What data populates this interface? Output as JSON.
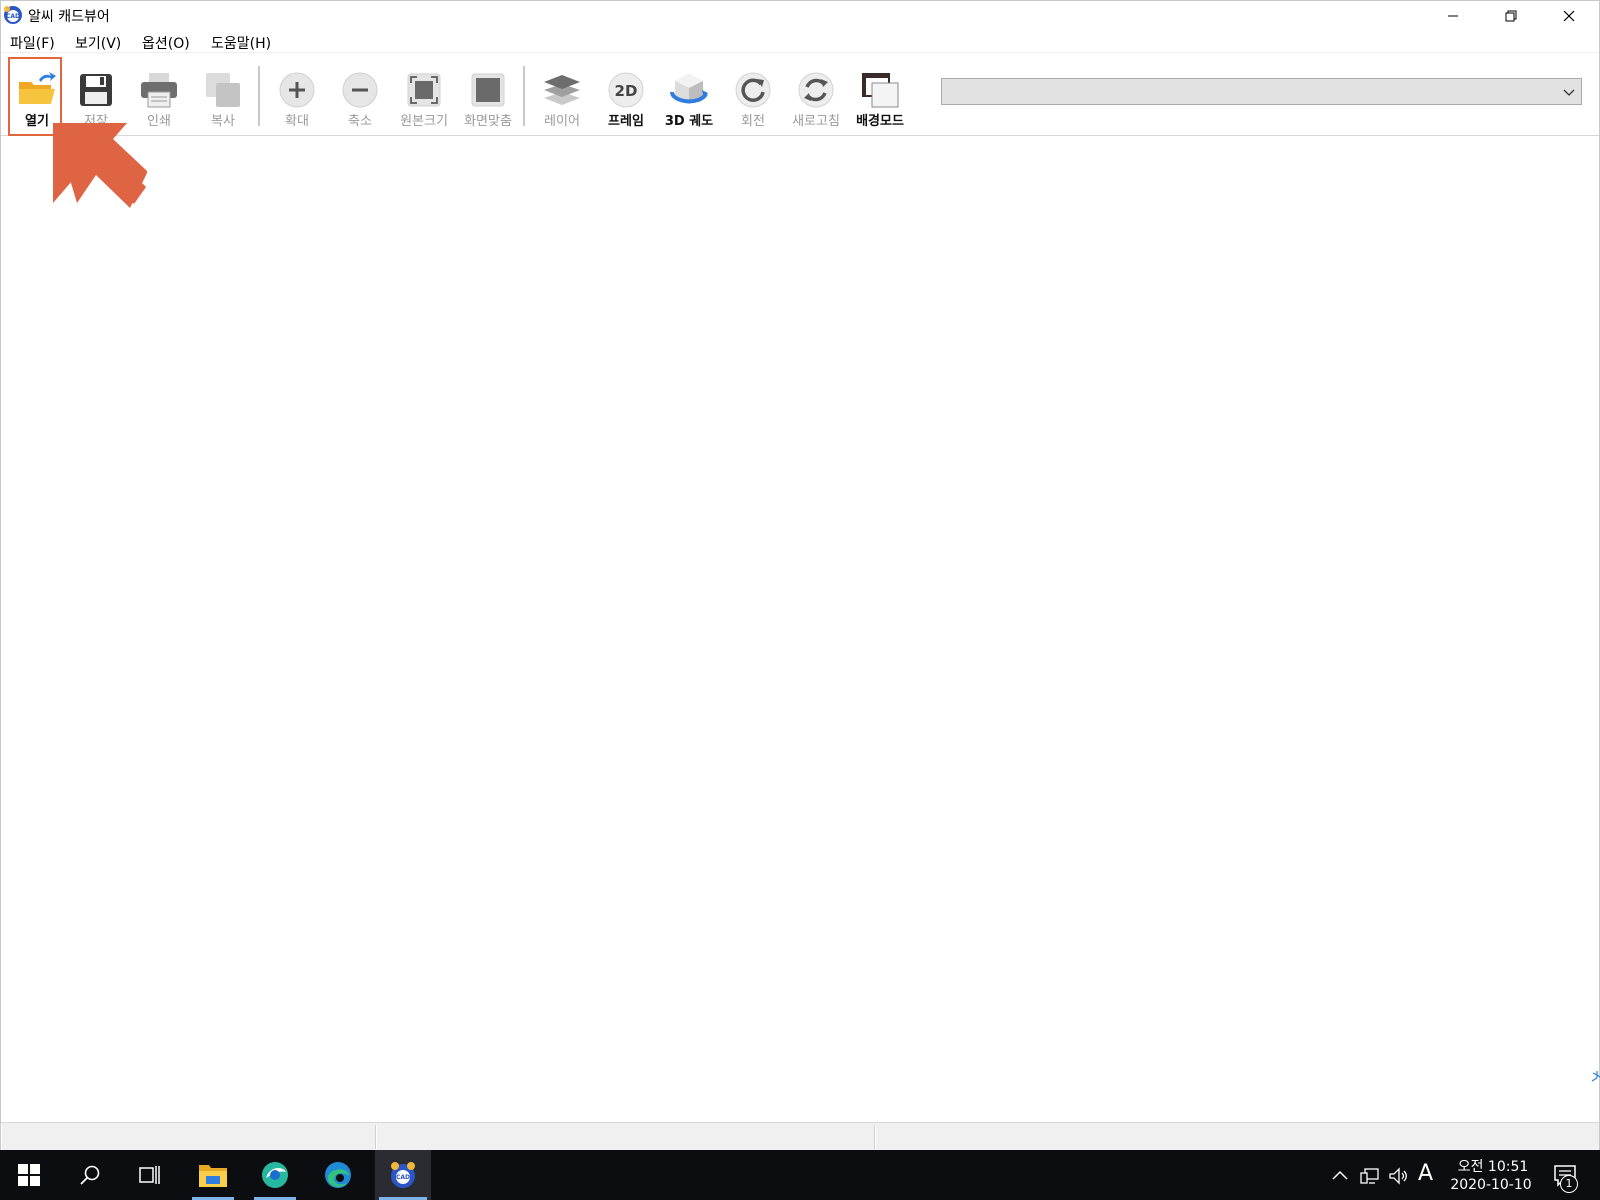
{
  "window": {
    "title": "알씨 캐드뷰어",
    "app_icon": "alsee-cad-icon"
  },
  "menu": [
    "파일(F)",
    "보기(V)",
    "옵션(O)",
    "도움말(H)"
  ],
  "toolbar": {
    "buttons": [
      {
        "id": "open",
        "label": "열기",
        "icon": "open-folder-icon",
        "enabled": true,
        "selected": true
      },
      {
        "id": "save",
        "label": "저장",
        "icon": "save-disk-icon",
        "enabled": false
      },
      {
        "id": "print",
        "label": "인쇄",
        "icon": "printer-icon",
        "enabled": false
      },
      {
        "id": "copy",
        "label": "복사",
        "icon": "copy-icon",
        "enabled": false
      },
      {
        "id": "zoom-in",
        "label": "확대",
        "icon": "plus-circle-icon",
        "enabled": false
      },
      {
        "id": "zoom-out",
        "label": "축소",
        "icon": "minus-circle-icon",
        "enabled": false
      },
      {
        "id": "original-size",
        "label": "원본크기",
        "icon": "original-size-icon",
        "enabled": false
      },
      {
        "id": "fit-screen",
        "label": "화면맞춤",
        "icon": "fit-screen-icon",
        "enabled": false
      },
      {
        "id": "layer",
        "label": "레이어",
        "icon": "layers-icon",
        "enabled": false
      },
      {
        "id": "frame",
        "label": "프레임",
        "icon": "2d-frame-icon",
        "icon_text": "2D",
        "enabled": true
      },
      {
        "id": "orbit",
        "label": "3D 궤도",
        "icon": "3d-orbit-icon",
        "enabled": true
      },
      {
        "id": "rotate",
        "label": "회전",
        "icon": "rotate-icon",
        "enabled": false
      },
      {
        "id": "refresh",
        "label": "새로고침",
        "icon": "refresh-icon",
        "enabled": false
      },
      {
        "id": "background-mode",
        "label": "배경모드",
        "icon": "background-mode-icon",
        "enabled": true
      }
    ],
    "layer_dropdown": {
      "value": "",
      "icon": "chevron-down-icon"
    }
  },
  "canvas": {
    "pointer_arrow_color": "#df6443"
  },
  "statusbar": {
    "cells": [
      "",
      "",
      ""
    ]
  },
  "taskbar": {
    "apps": [
      "windows-start-icon",
      "search-icon",
      "task-view-icon",
      "file-explorer-icon",
      "alsee-browser-icon",
      "edge-icon",
      "alsee-cad-viewer-icon"
    ],
    "tray": {
      "time": "오전 10:51",
      "date": "2020-10-10",
      "ime": "A",
      "notification_count": "1"
    }
  },
  "colors": {
    "accent_highlight": "#e2653c",
    "taskbar_bg": "#0c0d10",
    "disabled_text": "#9a9a9a"
  }
}
